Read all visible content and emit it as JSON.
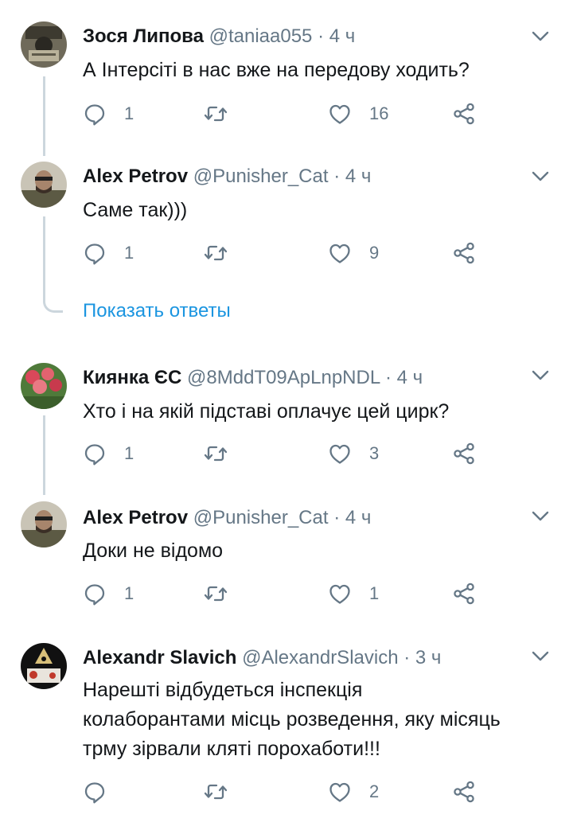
{
  "colors": {
    "link": "#1b95e0",
    "meta": "#657786",
    "text": "#14171a",
    "thread": "#ccd6dd"
  },
  "tweets": [
    {
      "name": "Зося Липова",
      "handle": "@taniaa055",
      "sep": "·",
      "time": "4 ч",
      "text": "А Інтерсіті в нас вже на передову ходить?",
      "replies": "1",
      "retweets": "",
      "likes": "16"
    },
    {
      "name": "Alex Petrov",
      "handle": "@Punisher_Cat",
      "sep": "·",
      "time": "4 ч",
      "text": "Саме так)))",
      "replies": "1",
      "retweets": "",
      "likes": "9"
    },
    {
      "name": "Киянка ЄС",
      "handle": "@8MddT09ApLnpNDL",
      "sep": "·",
      "time": "4 ч",
      "text": "Хто і на якій підставі оплачує цей цирк?",
      "replies": "1",
      "retweets": "",
      "likes": "3"
    },
    {
      "name": "Alex Petrov",
      "handle": "@Punisher_Cat",
      "sep": "·",
      "time": "4 ч",
      "text": "Доки не відомо",
      "replies": "1",
      "retweets": "",
      "likes": "1"
    },
    {
      "name": "Alexandr Slavich",
      "handle": "@AlexandrSlavich",
      "sep": "·",
      "time": "3 ч",
      "text": "Нарешті відбудеться інспекція колаборантами місць розведення, яку місяць трму зірвали кляті порохаботи!!!",
      "replies": "",
      "retweets": "",
      "likes": "2"
    }
  ],
  "show_replies": "Показать ответы",
  "icons": {
    "reply": "reply-icon",
    "retweet": "retweet-icon",
    "like": "heart-icon",
    "share": "share-icon",
    "caret": "chevron-down-icon"
  }
}
